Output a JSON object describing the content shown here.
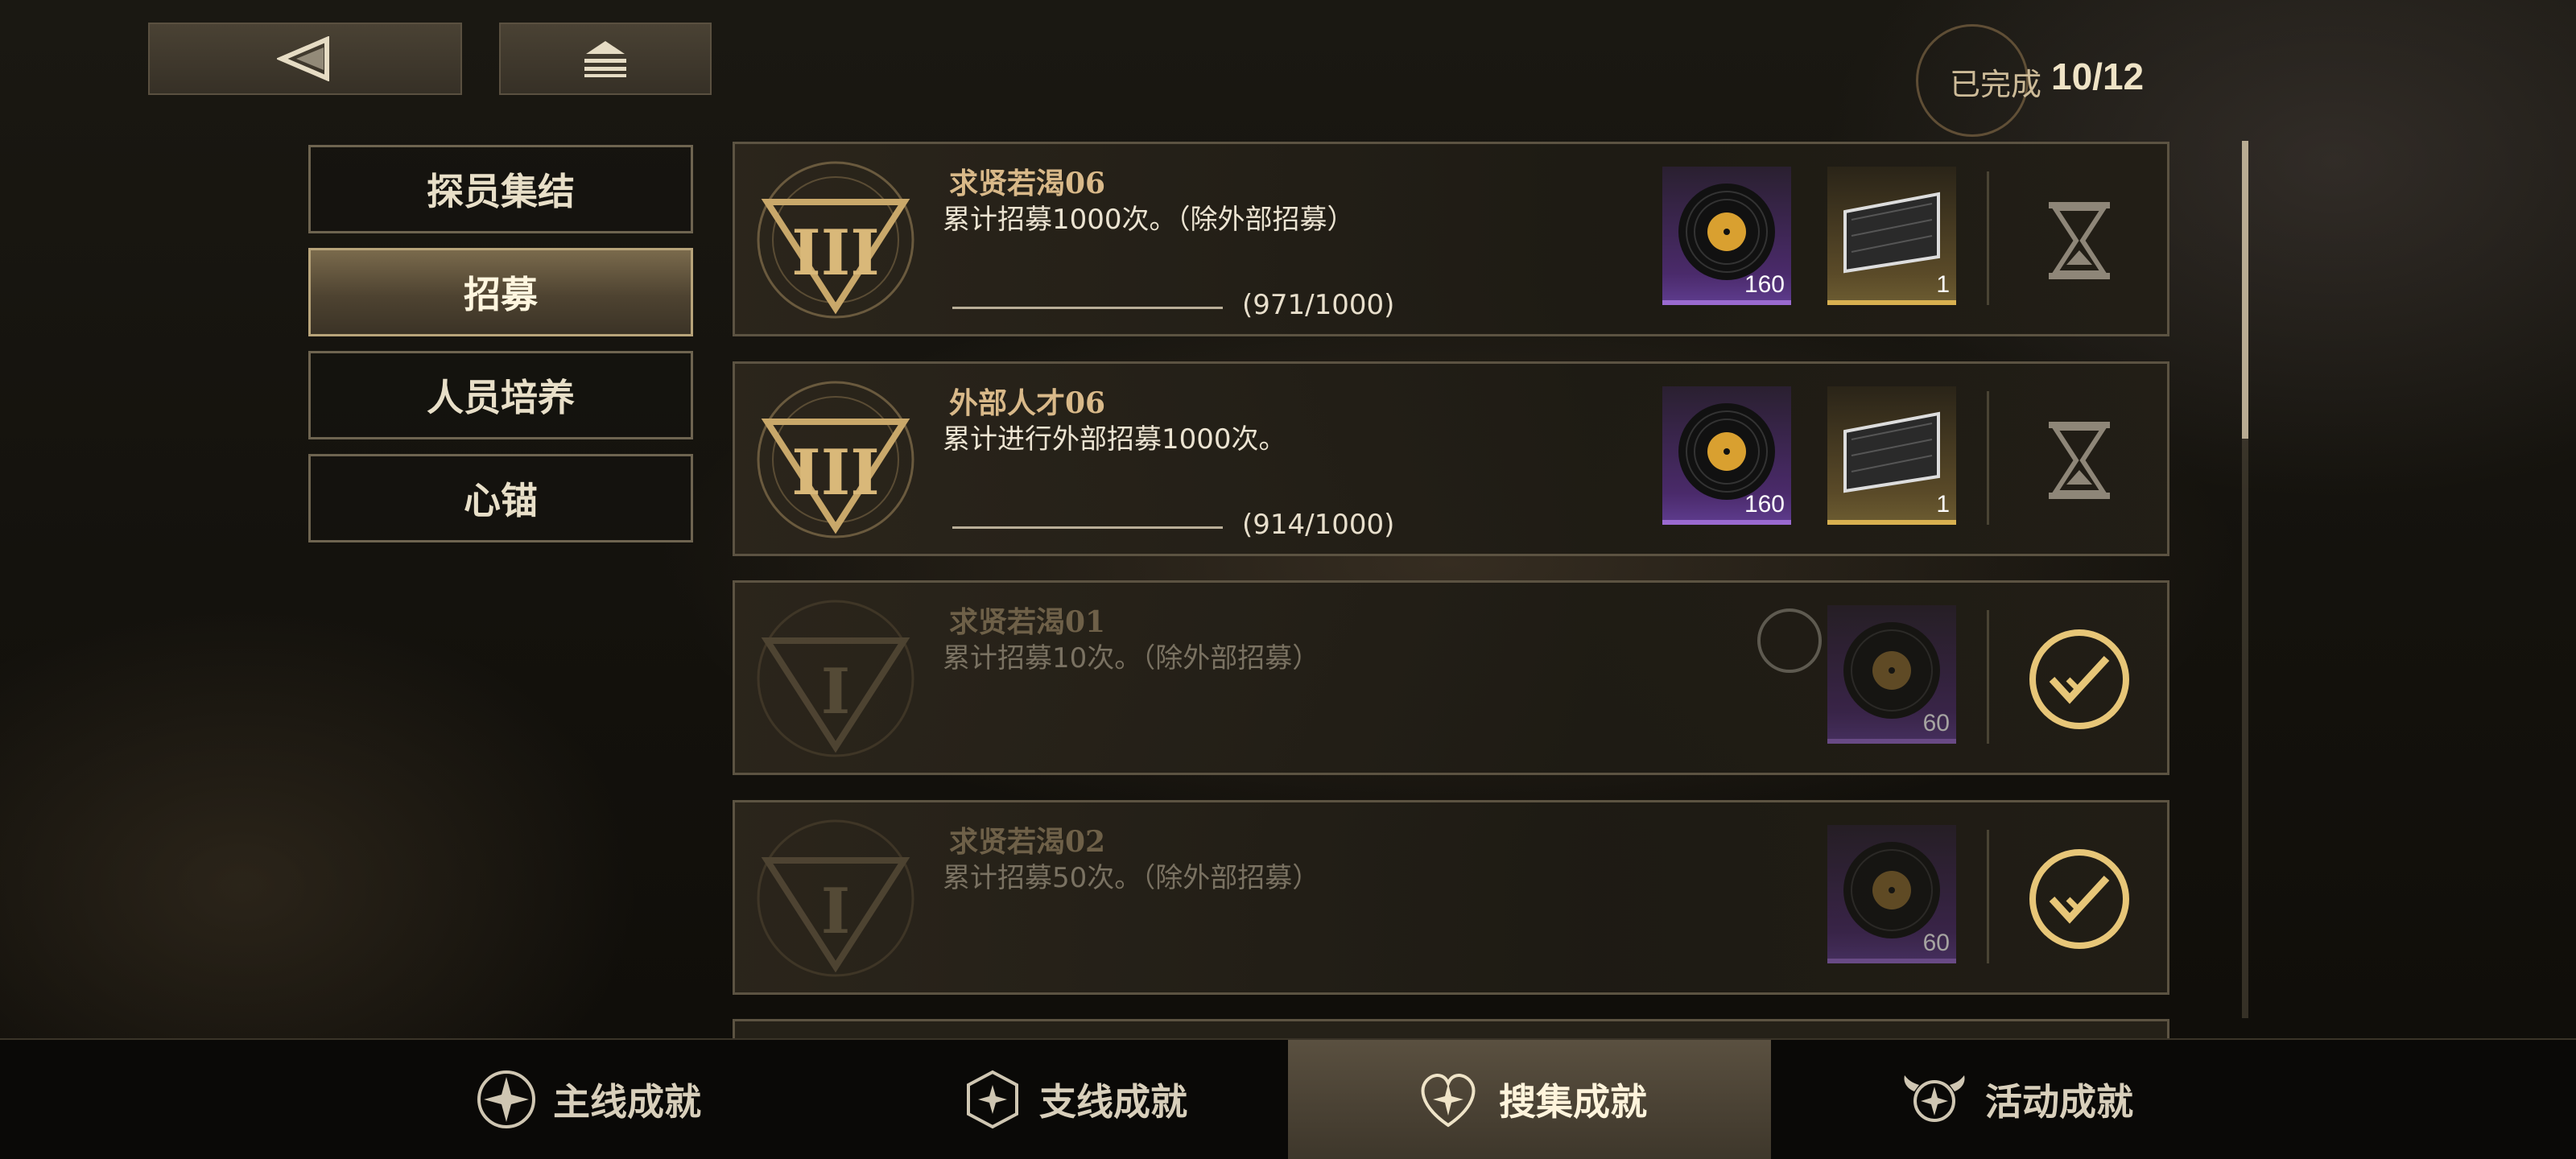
{
  "nav": {
    "back_icon": "back-triangle-icon",
    "home_icon": "home-stack-icon"
  },
  "progress": {
    "label": "已完成",
    "value": "10/12"
  },
  "side_tabs": [
    {
      "label": "探员集结",
      "active": false
    },
    {
      "label": "招募",
      "active": true
    },
    {
      "label": "人员培养",
      "active": false
    },
    {
      "label": "心锚",
      "active": false
    }
  ],
  "achievements": [
    {
      "title": "求贤若渴06",
      "description": "累计招募1000次。（除外部招募）",
      "progress_text": "(971/1000)",
      "progress": 0.971,
      "tier": "III",
      "rewards": [
        {
          "type": "record",
          "quantity": "160",
          "rarity": "purple"
        },
        {
          "type": "card",
          "quantity": "1",
          "rarity": "gold"
        }
      ],
      "state": "in-progress",
      "state_icon": "hourglass-icon"
    },
    {
      "title": "外部人才06",
      "description": "累计进行外部招募1000次。",
      "progress_text": "(914/1000)",
      "progress": 0.914,
      "tier": "III",
      "rewards": [
        {
          "type": "record",
          "quantity": "160",
          "rarity": "purple"
        },
        {
          "type": "card",
          "quantity": "1",
          "rarity": "gold"
        }
      ],
      "state": "in-progress",
      "state_icon": "hourglass-icon"
    },
    {
      "title": "求贤若渴01",
      "description": "累计招募10次。（除外部招募）",
      "tier": "I",
      "rewards": [
        {
          "type": "record",
          "quantity": "60",
          "rarity": "purple"
        }
      ],
      "state": "completed",
      "state_icon": "check-circle-icon"
    },
    {
      "title": "求贤若渴02",
      "description": "累计招募50次。（除外部招募）",
      "tier": "I",
      "rewards": [
        {
          "type": "record",
          "quantity": "60",
          "rarity": "purple"
        }
      ],
      "state": "completed",
      "state_icon": "check-circle-icon"
    }
  ],
  "bottom_tabs": [
    {
      "label": "主线成就",
      "icon": "main-star-shield-icon",
      "active": false
    },
    {
      "label": "支线成就",
      "icon": "side-hex-icon",
      "active": false
    },
    {
      "label": "搜集成就",
      "icon": "heart-star-icon",
      "active": true
    },
    {
      "label": "活动成就",
      "icon": "wing-star-icon",
      "active": false
    }
  ],
  "colors": {
    "accent_gold": "#d9b989",
    "purple_rarity": "#9a6ad0",
    "gold_rarity": "#d8b050"
  }
}
